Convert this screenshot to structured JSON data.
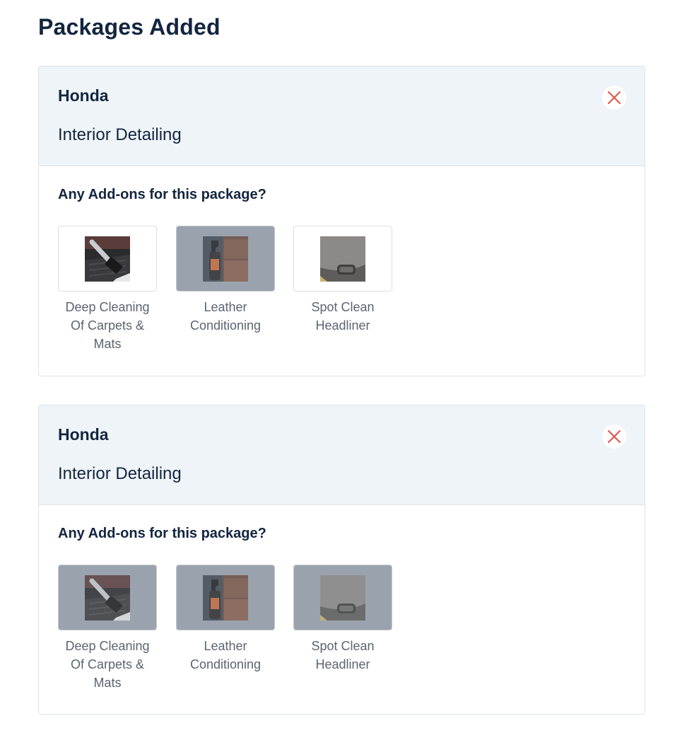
{
  "page": {
    "title": "Packages Added"
  },
  "packages": [
    {
      "vehicle": "Honda",
      "package": "Interior Detailing",
      "addons_prompt": "Any Add-ons for this package?",
      "addons": [
        {
          "label": "Deep Cleaning Of Carpets & Mats",
          "icon": "carpet-vacuum-photo",
          "selected": false
        },
        {
          "label": "Leather Conditioning",
          "icon": "leather-spray-photo",
          "selected": true
        },
        {
          "label": "Spot Clean Headliner",
          "icon": "headliner-photo",
          "selected": false
        }
      ]
    },
    {
      "vehicle": "Honda",
      "package": "Interior Detailing",
      "addons_prompt": "Any Add-ons for this package?",
      "addons": [
        {
          "label": "Deep Cleaning Of Carpets & Mats",
          "icon": "carpet-vacuum-photo",
          "selected": true
        },
        {
          "label": "Leather Conditioning",
          "icon": "leather-spray-photo",
          "selected": true
        },
        {
          "label": "Spot Clean Headliner",
          "icon": "headliner-photo",
          "selected": true
        }
      ]
    }
  ],
  "colors": {
    "title_text": "#13253f",
    "header_bg": "#eff4f8",
    "remove_icon": "#e0534a",
    "selected_tile_bg": "#9aa3ad",
    "label_text": "#5b6470"
  }
}
